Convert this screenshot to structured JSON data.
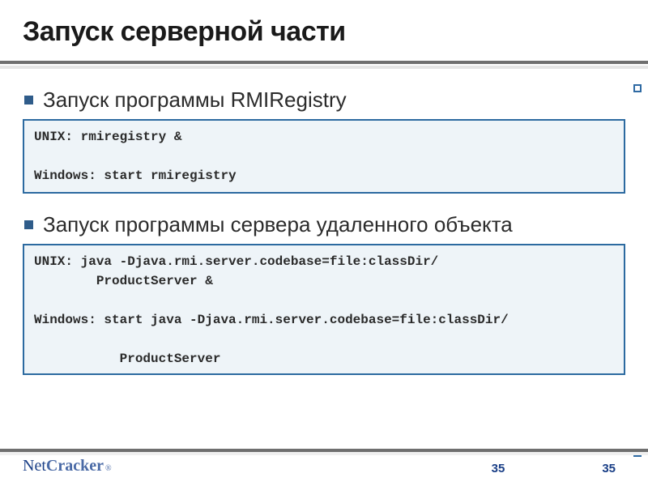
{
  "title": "Запуск серверной части",
  "bullets": {
    "b1": "Запуск программы RMIRegistry",
    "b2": "Запуск программы сервера удаленного объекта"
  },
  "code": {
    "box1": "UNIX: rmiregistry &\n\nWindows: start rmiregistry",
    "box2": "UNIX: java -Djava.rmi.server.codebase=file:classDir/\n        ProductServer &\n\nWindows: start java -Djava.rmi.server.codebase=file:classDir/\n\n           ProductServer"
  },
  "footer": {
    "logo_net": "Net",
    "logo_cracker": "Cracker",
    "logo_reg": "®",
    "page_a": "35",
    "page_b": "35"
  }
}
